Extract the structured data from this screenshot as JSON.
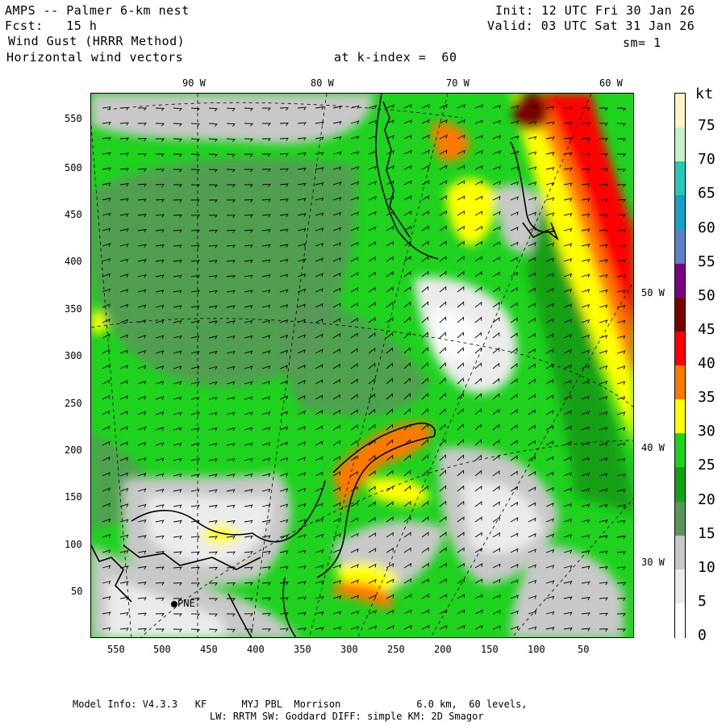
{
  "header": {
    "title": "AMPS -- Palmer 6-km nest",
    "forecast": "Fcst:   15 h",
    "field": "Wind Gust (HRRR Method)",
    "subfield": "Horizontal wind vectors",
    "init": "Init: 12 UTC Fri 30 Jan 26",
    "valid": "Valid: 03 UTC Sat 31 Jan 26",
    "smoothing": "sm= 1",
    "level": "at k-index =  60"
  },
  "map": {
    "top_lon_labels": [
      "90 W",
      "80 W",
      "70 W",
      "60 W"
    ],
    "right_lon_labels": [
      "50 W",
      "40 W",
      "30 W"
    ],
    "y_ticks": [
      "550",
      "500",
      "450",
      "400",
      "350",
      "300",
      "250",
      "200",
      "150",
      "100",
      "50"
    ],
    "x_ticks": [
      "550",
      "500",
      "450",
      "400",
      "350",
      "300",
      "250",
      "200",
      "150",
      "100",
      "50"
    ],
    "station_label": "PNE"
  },
  "colorbar": {
    "unit": "kt",
    "levels": [
      "75",
      "70",
      "65",
      "60",
      "55",
      "50",
      "45",
      "40",
      "35",
      "30",
      "25",
      "20",
      "15",
      "10",
      "5",
      "0"
    ],
    "colors": [
      "#fff5c8",
      "#c8f0c8",
      "#28c8b4",
      "#19a0c8",
      "#5a82c8",
      "#780082",
      "#780000",
      "#ff0000",
      "#ff7800",
      "#ffff00",
      "#1ed21e",
      "#14a014",
      "#5a965a",
      "#c8c8c8",
      "#ebebeb",
      "#ffffff"
    ]
  },
  "footer": {
    "line1": "Model Info: V4.3.3   KF      MYJ PBL  Morrison             6.0 km,  60 levels,",
    "line2": "LW: RRTM SW: Goddard DIFF: simple KM: 2D Smagor"
  }
}
